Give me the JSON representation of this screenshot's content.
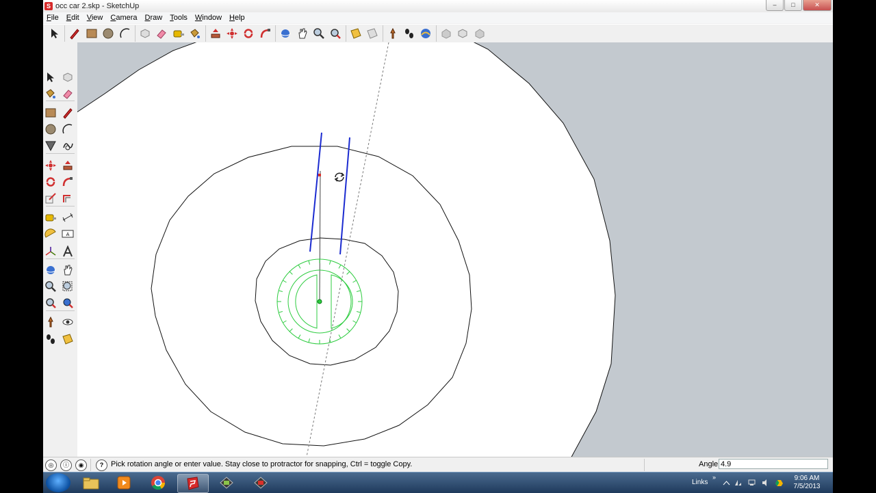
{
  "window": {
    "title": "occ car 2.skp - SketchUp",
    "app_icon_glyph": "S",
    "buttons": {
      "minimize": "–",
      "maximize": "□",
      "close": "✕"
    }
  },
  "menu": [
    {
      "underlined": "F",
      "rest": "ile"
    },
    {
      "underlined": "E",
      "rest": "dit"
    },
    {
      "underlined": "V",
      "rest": "iew"
    },
    {
      "underlined": "C",
      "rest": "amera"
    },
    {
      "underlined": "D",
      "rest": "raw"
    },
    {
      "underlined": "T",
      "rest": "ools"
    },
    {
      "underlined": "W",
      "rest": "indow"
    },
    {
      "underlined": "H",
      "rest": "elp"
    }
  ],
  "toolbar_icons": [
    "select-tool-icon",
    "pencil-line-icon",
    "rectangle-icon",
    "circle-icon",
    "arc-icon",
    "make-component-icon",
    "eraser-icon",
    "tape-measure-icon",
    "paint-bucket-icon",
    "push-pull-icon",
    "move-icon",
    "rotate-icon",
    "follow-me-icon",
    "orbit-icon",
    "pan-icon",
    "zoom-icon",
    "zoom-extents-icon",
    "section-plane-icon",
    "section-display-icon",
    "position-camera-icon",
    "walk-icon",
    "get-models-icon",
    "share-model-icon",
    "share-component-icon",
    "upload-icon"
  ],
  "left_tools": [
    [
      "select-tool-icon",
      "make-component-icon"
    ],
    [
      "paint-bucket-icon",
      "eraser-icon"
    ],
    [
      "rectangle-icon",
      "pencil-line-icon"
    ],
    [
      "circle-icon",
      "arc-icon"
    ],
    [
      "polygon-icon",
      "freehand-icon"
    ],
    [
      "move-icon",
      "push-pull-icon"
    ],
    [
      "rotate-icon",
      "follow-me-icon"
    ],
    [
      "scale-icon",
      "offset-icon"
    ],
    [
      "tape-measure-icon",
      "dimension-icon"
    ],
    [
      "protractor-icon",
      "text-icon"
    ],
    [
      "axes-icon",
      "3d-text-icon"
    ],
    [
      "orbit-icon",
      "pan-icon"
    ],
    [
      "zoom-icon",
      "zoom-window-icon"
    ],
    [
      "zoom-extents-icon",
      "previous-view-icon"
    ],
    [
      "position-camera-icon",
      "look-around-icon"
    ],
    [
      "walk-icon",
      "section-plane-icon"
    ]
  ],
  "status": {
    "hint": "Pick rotation angle or enter value.  Stay close to protractor for snapping, Ctrl = toggle Copy.",
    "vcb_label": "Angle",
    "vcb_value": "4.9"
  },
  "taskbar": {
    "apps": [
      "windows-explorer",
      "media-player",
      "google-chrome",
      "sketchup",
      "app-window-5",
      "app-window-6"
    ],
    "active_app": "sketchup",
    "links_label": "Links",
    "links_chevron": "»",
    "time": "9:06 AM",
    "date": "7/5/2013"
  },
  "colors": {
    "viewport_bg": "#c3c9cf",
    "protractor": "#2ecc40",
    "selection_edges": "#1b2bd0",
    "inference_point": "#d9302a"
  }
}
